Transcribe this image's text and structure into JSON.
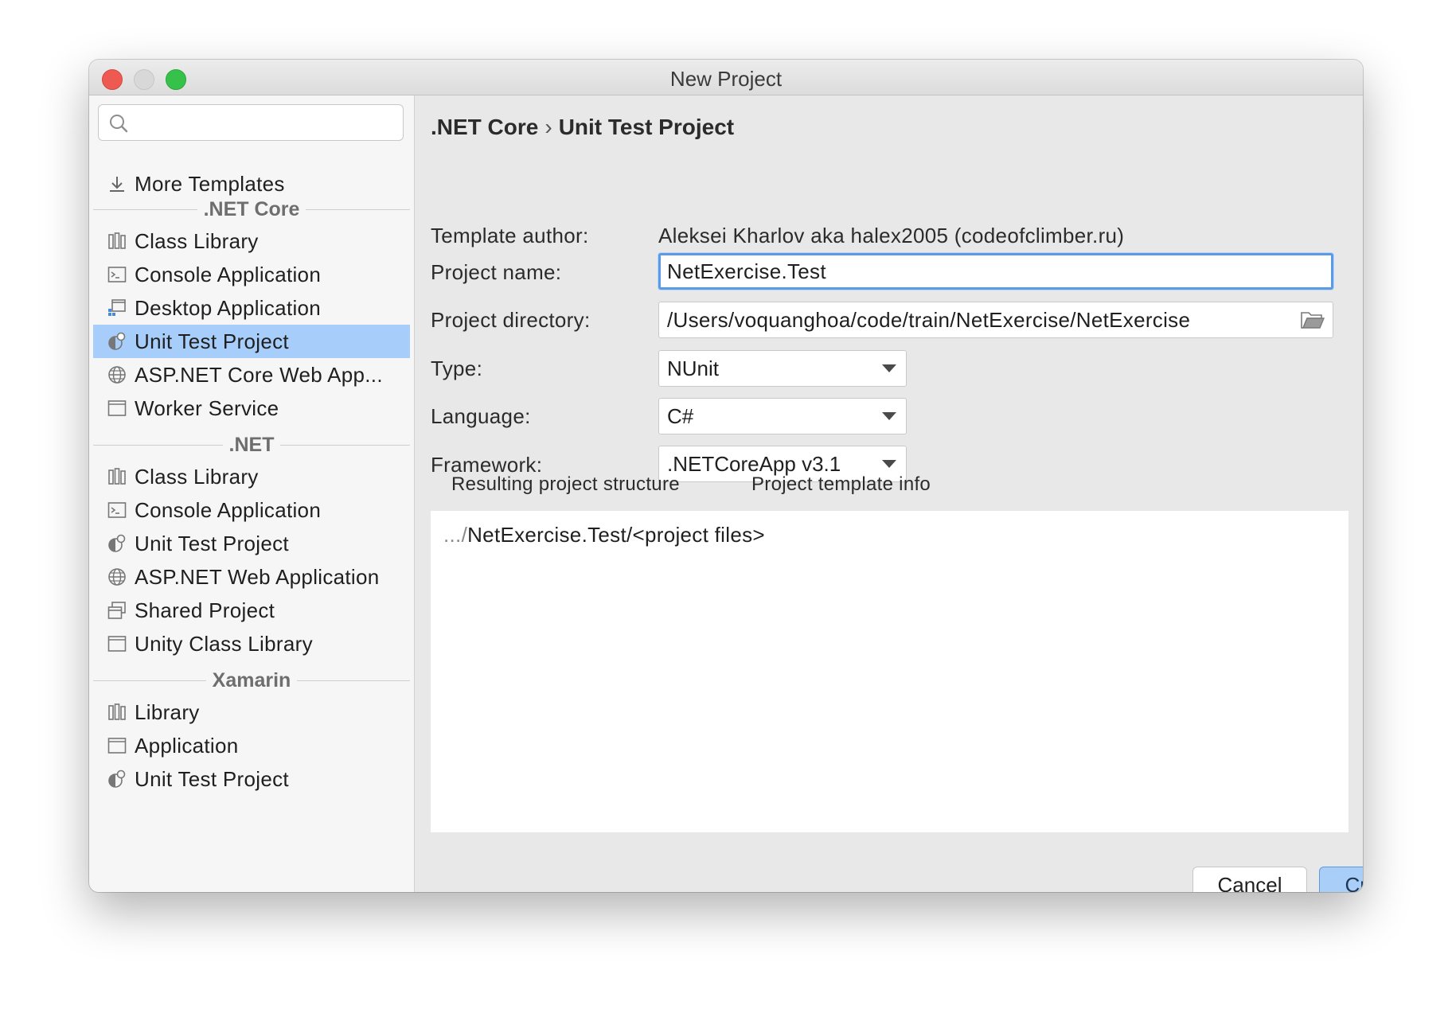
{
  "window": {
    "title": "New Project"
  },
  "sidebar": {
    "search": {
      "placeholder": ""
    },
    "more_templates": "More Templates",
    "groups": [
      {
        "title": ".NET Core",
        "items": [
          {
            "label": "Class Library",
            "icon": "library-icon"
          },
          {
            "label": "Console Application",
            "icon": "console-icon"
          },
          {
            "label": "Desktop Application",
            "icon": "desktop-app-icon"
          },
          {
            "label": "Unit Test Project",
            "icon": "unit-test-icon",
            "selected": true
          },
          {
            "label": "ASP.NET Core Web App...",
            "icon": "globe-icon"
          },
          {
            "label": "Worker Service",
            "icon": "window-icon"
          }
        ]
      },
      {
        "title": ".NET",
        "items": [
          {
            "label": "Class Library",
            "icon": "library-icon"
          },
          {
            "label": "Console Application",
            "icon": "console-icon"
          },
          {
            "label": "Unit Test Project",
            "icon": "unit-test-icon"
          },
          {
            "label": "ASP.NET Web Application",
            "icon": "globe-icon"
          },
          {
            "label": "Shared Project",
            "icon": "shared-project-icon"
          },
          {
            "label": "Unity Class Library",
            "icon": "window-icon"
          }
        ]
      },
      {
        "title": "Xamarin",
        "items": [
          {
            "label": "Library",
            "icon": "library-icon"
          },
          {
            "label": "Application",
            "icon": "window-icon"
          },
          {
            "label": "Unit Test Project",
            "icon": "unit-test-icon"
          }
        ]
      }
    ]
  },
  "main": {
    "breadcrumb": {
      "category": ".NET Core",
      "separator": "›",
      "template": "Unit Test Project"
    },
    "form": {
      "author_label": "Template author:",
      "author_value": "Aleksei Kharlov aka halex2005 (codeofclimber.ru)",
      "name_label": "Project name:",
      "name_value": "NetExercise.Test",
      "directory_label": "Project directory:",
      "directory_value": "/Users/voquanghoa/code/train/NetExercise/NetExercise",
      "type_label": "Type:",
      "type_value": "NUnit",
      "language_label": "Language:",
      "language_value": "C#",
      "framework_label": "Framework:",
      "framework_value": ".NETCoreApp v3.1"
    },
    "tabs": [
      {
        "label": "Resulting project structure",
        "active": true
      },
      {
        "label": "Project template info",
        "active": false
      }
    ],
    "structure": {
      "prefix": ".../",
      "path": "NetExercise.Test/<project files>"
    },
    "buttons": {
      "cancel": "Cancel",
      "create": "Create"
    }
  },
  "colors": {
    "selection": "#a7cdfa",
    "accent": "#5b9be6",
    "close": "#ee5a52",
    "maximize": "#36c14a"
  }
}
